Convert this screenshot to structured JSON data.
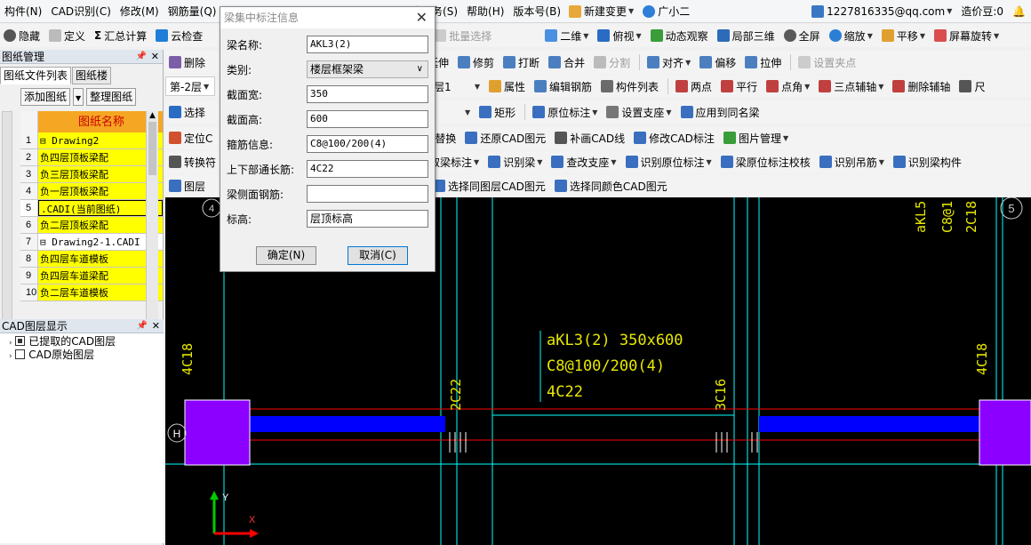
{
  "menubar": {
    "items": [
      "构件(N)",
      "CAD识别(C)",
      "修改(M)",
      "钢筋量(Q)",
      "线服务(S)",
      "帮助(H)",
      "版本号(B)"
    ],
    "new_change": "新建变更",
    "assistant": "广小二",
    "account": "1227816335@qq.com",
    "cost_beans": "造价豆:0"
  },
  "toolbar1": {
    "left": [
      "隐藏",
      "定义",
      "汇总计算",
      "云检查"
    ],
    "mid": "批量选择",
    "right": [
      "二维",
      "俯视",
      "动态观察",
      "局部三维",
      "全屏",
      "缩放",
      "平移",
      "屏幕旋转"
    ]
  },
  "toolbar2": {
    "left": "删除",
    "right": [
      "延伸",
      "修剪",
      "打断",
      "合并",
      "分割",
      "对齐",
      "偏移",
      "拉伸",
      "设置夹点"
    ]
  },
  "toolbar3": {
    "floor": "第-2层",
    "layer_frag": "层1",
    "right": [
      "属性",
      "编辑钢筋",
      "构件列表",
      "两点",
      "平行",
      "点角",
      "三点辅轴",
      "删除辅轴",
      "尺"
    ]
  },
  "toolbar4": {
    "left": "选择",
    "right": [
      "矩形",
      "原位标注",
      "设置支座",
      "应用到同名梁"
    ]
  },
  "toolbar5": {
    "left": "定位C",
    "right": [
      "替换",
      "还原CAD图元",
      "补画CAD线",
      "修改CAD标注",
      "图片管理"
    ]
  },
  "toolbar6": {
    "left": "转换符",
    "right": [
      "取梁标注",
      "识别梁",
      "查改支座",
      "识别原位标注",
      "梁原位标注校核",
      "识别吊筋",
      "识别梁构件"
    ]
  },
  "toolbar7": {
    "left": "图层",
    "right": [
      "选择同图层CAD图元",
      "选择同颜色CAD图元"
    ]
  },
  "drawing_panel": {
    "title": "图纸管理",
    "tabs": [
      "图纸文件列表",
      "图纸楼"
    ],
    "add_btn": "添加图纸",
    "sort_btn": "整理图纸",
    "col_header": "图纸名称",
    "rows": [
      {
        "num": "1",
        "name": "⊟ Drawing2",
        "yellow": true
      },
      {
        "num": "2",
        "name": "  负四层顶板梁配",
        "yellow": true
      },
      {
        "num": "3",
        "name": "  负三层顶板梁配",
        "yellow": true
      },
      {
        "num": "4",
        "name": "  负一层顶板梁配",
        "yellow": true
      },
      {
        "num": "5",
        "name": ".CADI(当前图纸)",
        "yellow": true
      },
      {
        "num": "6",
        "name": "  负二层顶板梁配",
        "yellow": true
      },
      {
        "num": "7",
        "name": "⊟ Drawing2-1.CADI",
        "yellow": false
      },
      {
        "num": "8",
        "name": "  负四层车道模板",
        "yellow": true
      },
      {
        "num": "9",
        "name": "  负四层车道梁配",
        "yellow": true
      },
      {
        "num": "10",
        "name": "  负二层车道模板",
        "yellow": true
      }
    ]
  },
  "layer_panel": {
    "title": "CAD图层显示",
    "items": [
      "已提取的CAD图层",
      "CAD原始图层"
    ]
  },
  "dialog": {
    "title": "梁集中标注信息",
    "fields": [
      {
        "label": "梁名称:",
        "value": "AKL3(2)"
      },
      {
        "label": "类别:",
        "value": "楼层框架梁"
      },
      {
        "label": "截面宽:",
        "value": "350"
      },
      {
        "label": "截面高:",
        "value": "600"
      },
      {
        "label": "箍筋信息:",
        "value": "C8@100/200(4)"
      },
      {
        "label": "上下部通长筋:",
        "value": "4C22"
      },
      {
        "label": "梁侧面钢筋:",
        "value": ""
      },
      {
        "label": "标高:",
        "value": "层顶标高"
      }
    ],
    "ok": "确定(N)",
    "cancel": "取消(C)"
  },
  "cad": {
    "beam_label": [
      "aKL3(2)  350x600",
      "C8@100/200(4)",
      "4C22"
    ],
    "texts": {
      "t_4c18_left": "4C18",
      "t_2c22": "2C22",
      "t_3c16": "3C16",
      "t_4c18_right": "4C18",
      "t_akl5": "aKL5",
      "t_c8": "C8@1",
      "t_2c18": "2C18",
      "axis_left": "4",
      "axis_right": "5",
      "axis_h": "H",
      "ucs_x": "X",
      "ucs_y": "Y"
    }
  },
  "colors": {
    "cad_bg": "#000000",
    "cyan_line": "#00ffff",
    "beam_blue": "#0000ff",
    "column_purple": "#8b00ff",
    "red_line": "#ff0000",
    "cad_text": "#ffff00"
  }
}
